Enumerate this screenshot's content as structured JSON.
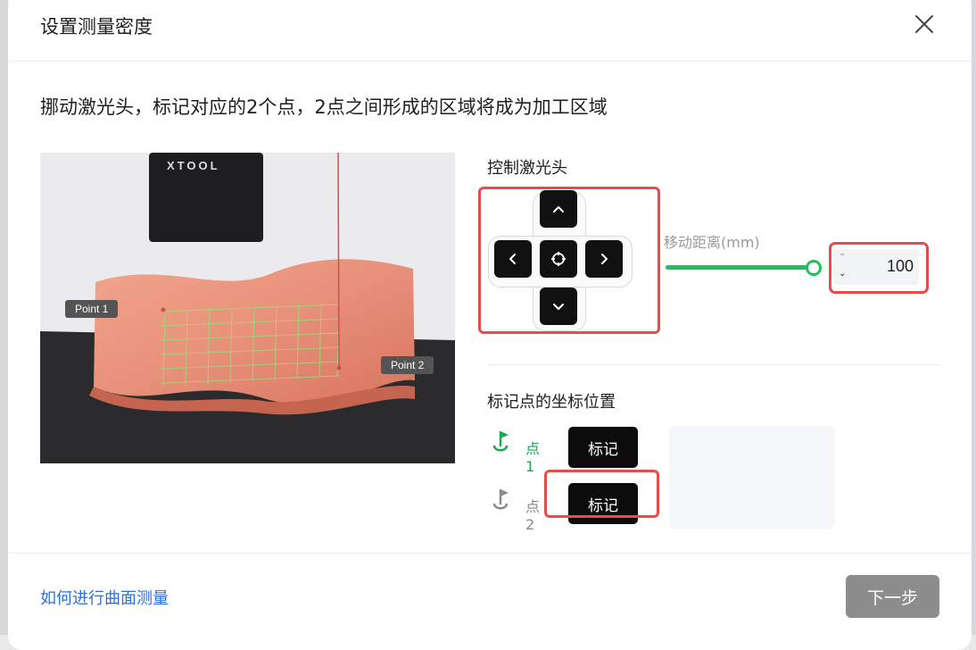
{
  "dialog": {
    "title": "设置测量密度",
    "instruction": "挪动激光头，标记对应的2个点，2点之间形成的区域将成为加工区域"
  },
  "illustration": {
    "brand": "XTOOL",
    "point1_label": "Point 1",
    "point2_label": "Point 2"
  },
  "control": {
    "title": "控制激光头",
    "distance_label": "移动距离(mm)",
    "distance_value": "100",
    "slider_value_fraction": 1.0,
    "icons": [
      "chevron-up-icon",
      "chevron-down-icon",
      "chevron-left-icon",
      "chevron-right-icon",
      "crosshair-icon"
    ]
  },
  "marking": {
    "title": "标记点的坐标位置",
    "points": [
      {
        "label": "点1",
        "button": "标记",
        "status_color": "#1aaa55"
      },
      {
        "label": "点2",
        "button": "标记",
        "status_color": "#8a8a8a"
      }
    ]
  },
  "footer": {
    "help_link": "如何进行曲面测量",
    "next_button": "下一步"
  },
  "colors": {
    "accent_green": "#1fc15d",
    "highlight_red": "#e94b4b",
    "link_blue": "#2c6fd8",
    "disabled_gray": "#8d8d8d"
  }
}
